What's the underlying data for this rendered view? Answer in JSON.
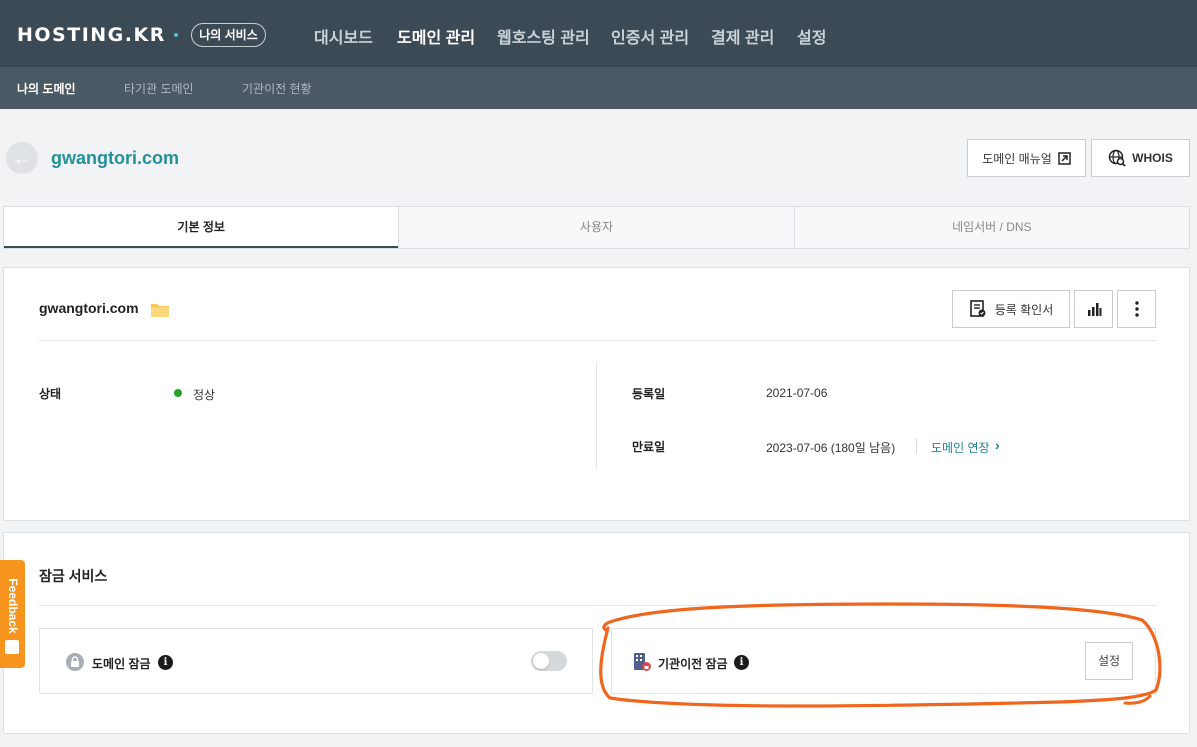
{
  "brand": {
    "logo": "HOSTING.KR",
    "my_service": "나의 서비스"
  },
  "main_nav": [
    "대시보드",
    "도메인 관리",
    "웹호스팅 관리",
    "인증서 관리",
    "결제 관리",
    "설정"
  ],
  "main_nav_active": "도메인 관리",
  "sub_nav": [
    "나의 도메인",
    "타기관 도메인",
    "기관이전 현황"
  ],
  "sub_nav_active": "나의 도메인",
  "page": {
    "domain": "gwangtori.com",
    "manual_button": "도메인 매뉴얼",
    "whois_button": "WHOIS"
  },
  "tabs": [
    "기본 정보",
    "사용자",
    "네임서버 / DNS"
  ],
  "info": {
    "domain": "gwangtori.com",
    "cert_button": "등록 확인서",
    "status_label": "상태",
    "status_value": "정상",
    "registered_label": "등록일",
    "registered_value": "2021-07-06",
    "expiry_label": "만료일",
    "expiry_value": "2023-07-06 (180일 남음)",
    "renew_link": "도메인 연장"
  },
  "lock": {
    "title": "잠금 서비스",
    "domain_lock_label": "도메인 잠금",
    "domain_lock_on": false,
    "transfer_lock_label": "기관이전 잠금",
    "transfer_lock_button": "설정"
  },
  "feedback": "Feedback",
  "colors": {
    "topbar": "#3c4a55",
    "subbar": "#4a5964",
    "accent": "#21919a",
    "status_ok": "#2aa12a",
    "annotation": "#f0661e",
    "feedback": "#f7941d"
  },
  "icons": [
    "back-arrow-icon",
    "external-link-icon",
    "globe-search-icon",
    "folder-icon",
    "certificate-icon",
    "bar-chart-icon",
    "more-vertical-icon",
    "lock-icon",
    "info-icon",
    "building-lock-icon",
    "chevron-right-icon"
  ]
}
